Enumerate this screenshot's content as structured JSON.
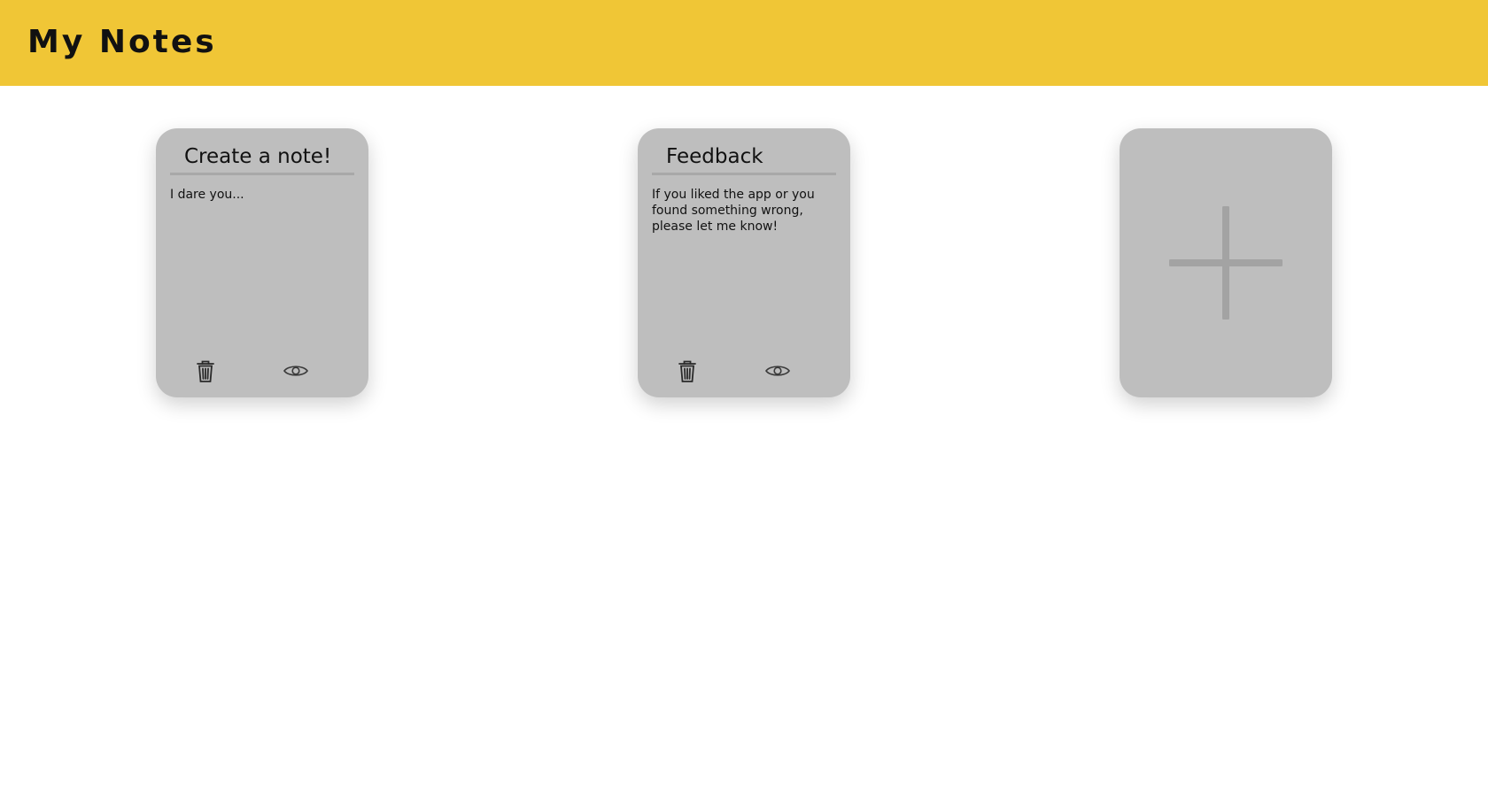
{
  "header": {
    "title": "My Notes",
    "background_color": "#f0c636"
  },
  "notes": [
    {
      "title": "Create a note!",
      "body": "I dare you...",
      "actions": [
        "trash-icon",
        "eye-icon"
      ]
    },
    {
      "title": "Feedback",
      "body": "If you liked the app or you found something wrong, please let me know!",
      "actions": [
        "trash-icon",
        "eye-icon"
      ]
    }
  ],
  "add_note": {
    "icon": "plus-icon"
  },
  "colors": {
    "card": "#bebebe",
    "divider": "#a8a8a8",
    "plus": "#a3a3a3",
    "text": "#111111"
  }
}
